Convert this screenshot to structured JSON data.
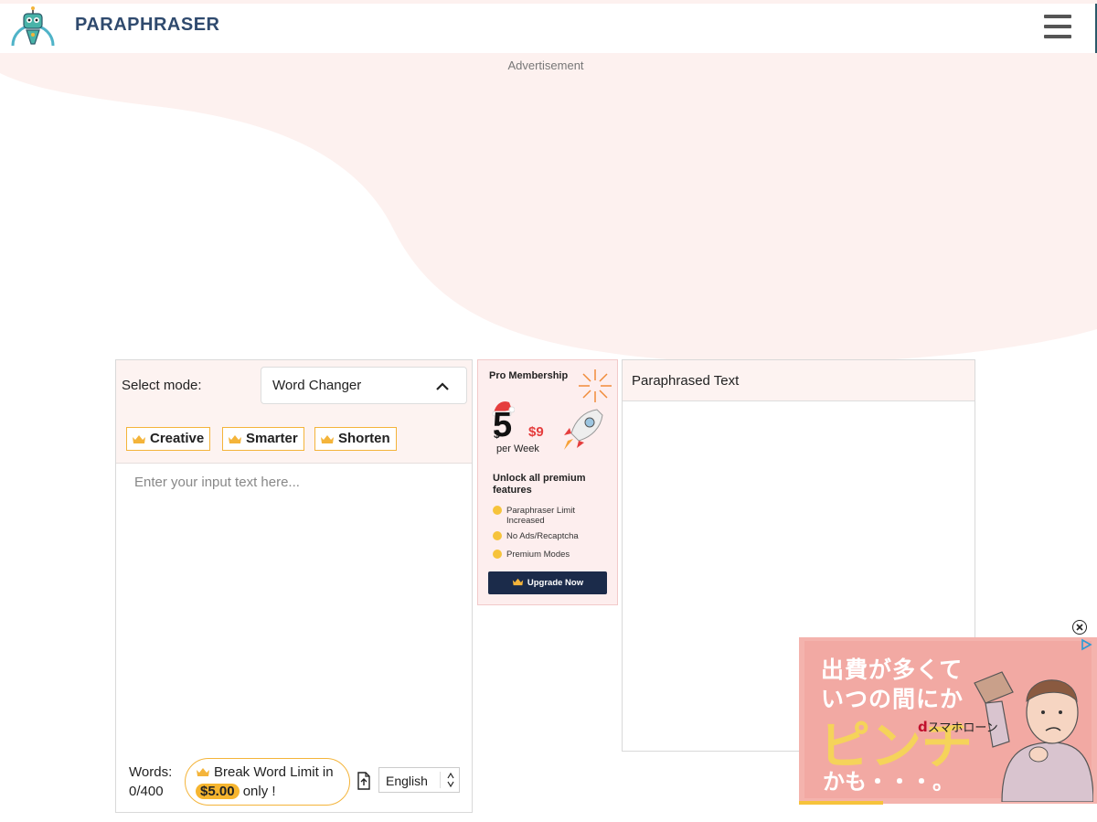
{
  "header": {
    "brand": "PARAPHRASER",
    "menu_icon": "hamburger-menu-icon"
  },
  "ad": {
    "label": "Advertisement"
  },
  "editor": {
    "mode_label": "Select mode:",
    "mode_selected": "Word Changer",
    "modes": [
      {
        "label": "Creative",
        "icon": "crown-icon"
      },
      {
        "label": "Smarter",
        "icon": "crown-icon"
      },
      {
        "label": "Shorten",
        "icon": "crown-icon"
      }
    ],
    "input_placeholder": "Enter your input text here...",
    "input_value": "",
    "words_label": "Words:",
    "words_count": "0/400",
    "break_limit": {
      "text": "Break Word Limit in",
      "price": "$5.00",
      "suffix": "only !"
    },
    "language": "English"
  },
  "promo": {
    "title": "Pro Membership",
    "dollar": "$",
    "price": "5",
    "old_price": "$9",
    "period": "per Week",
    "unlock": "Unlock all premium features",
    "features": [
      "Paraphraser Limit Increased",
      "No Ads/Recaptcha",
      "Premium Modes"
    ],
    "cta": "Upgrade Now"
  },
  "output": {
    "title": "Paraphrased Text"
  },
  "floating_ad": {
    "line1": "出費が多くて",
    "line2": "いつの間にか",
    "line3": "ピンチ",
    "line4": "かも・・・。",
    "brand_d": "d",
    "brand_rest": "スマホローン"
  },
  "colors": {
    "accent": "#f4b43a",
    "brand": "#2f4a6e",
    "panel_tint": "#fdf3f1",
    "promo_cta": "#1b2b4a"
  }
}
